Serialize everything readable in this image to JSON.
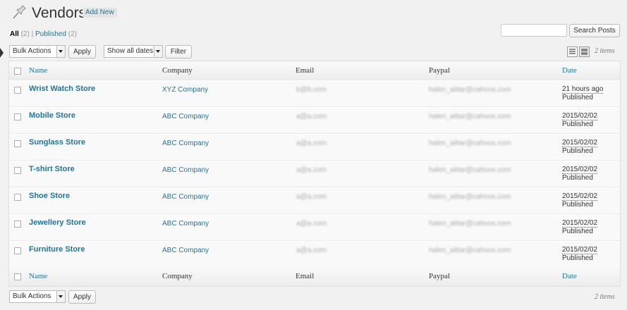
{
  "page": {
    "title": "Vendors",
    "add_new": "Add New"
  },
  "subsubsub": {
    "all_label": "All",
    "all_count": "(2)",
    "sep": "|",
    "published_label": "Published",
    "published_count": "(2)"
  },
  "search": {
    "button": "Search Posts",
    "value": ""
  },
  "toolbar_top": {
    "bulk": "Bulk Actions",
    "apply": "Apply",
    "dates": "Show all dates",
    "filter": "Filter",
    "count": "2 items"
  },
  "columns": {
    "name": "Name",
    "company": "Company",
    "email": "Email",
    "paypal": "Paypal",
    "date": "Date"
  },
  "rows": [
    {
      "name": "Wrist Watch Store",
      "company": "XYZ Company",
      "email": "b@b.com",
      "paypal": "halen_aittar@cahoos.com",
      "date": "21 hours ago",
      "status": "Published"
    },
    {
      "name": "Mobile Store",
      "company": "ABC Company",
      "email": "a@a.com",
      "paypal": "halen_aittar@cahoos.com",
      "date": "2015/02/02",
      "status": "Published"
    },
    {
      "name": "Sunglass Store",
      "company": "ABC Company",
      "email": "a@a.com",
      "paypal": "halen_aittar@cahoos.com",
      "date": "2015/02/02",
      "status": "Published"
    },
    {
      "name": "T-shirt Store",
      "company": "ABC Company",
      "email": "a@a.com",
      "paypal": "halen_aittar@cahoos.com",
      "date": "2015/02/02",
      "status": "Published"
    },
    {
      "name": "Shoe Store",
      "company": "ABC Company",
      "email": "a@a.com",
      "paypal": "halen_aittar@cahoos.com",
      "date": "2015/02/02",
      "status": "Published"
    },
    {
      "name": "Jewellery Store",
      "company": "ABC Company",
      "email": "a@a.com",
      "paypal": "halen_aittar@cahoos.com",
      "date": "2015/02/02",
      "status": "Published"
    },
    {
      "name": "Furniture Store",
      "company": "ABC Company",
      "email": "a@a.com",
      "paypal": "halen_aittar@cahoos.com",
      "date": "2015/02/02",
      "status": "Published"
    }
  ],
  "toolbar_bottom": {
    "bulk": "Bulk Actions",
    "apply": "Apply",
    "count": "2 items"
  },
  "colors": {
    "link": "#21759b",
    "background": "#f1f1f1"
  },
  "icons": {
    "page_icon": "pushpin-icon",
    "list_view": "list-view-icon",
    "excerpt_view": "excerpt-view-icon"
  }
}
